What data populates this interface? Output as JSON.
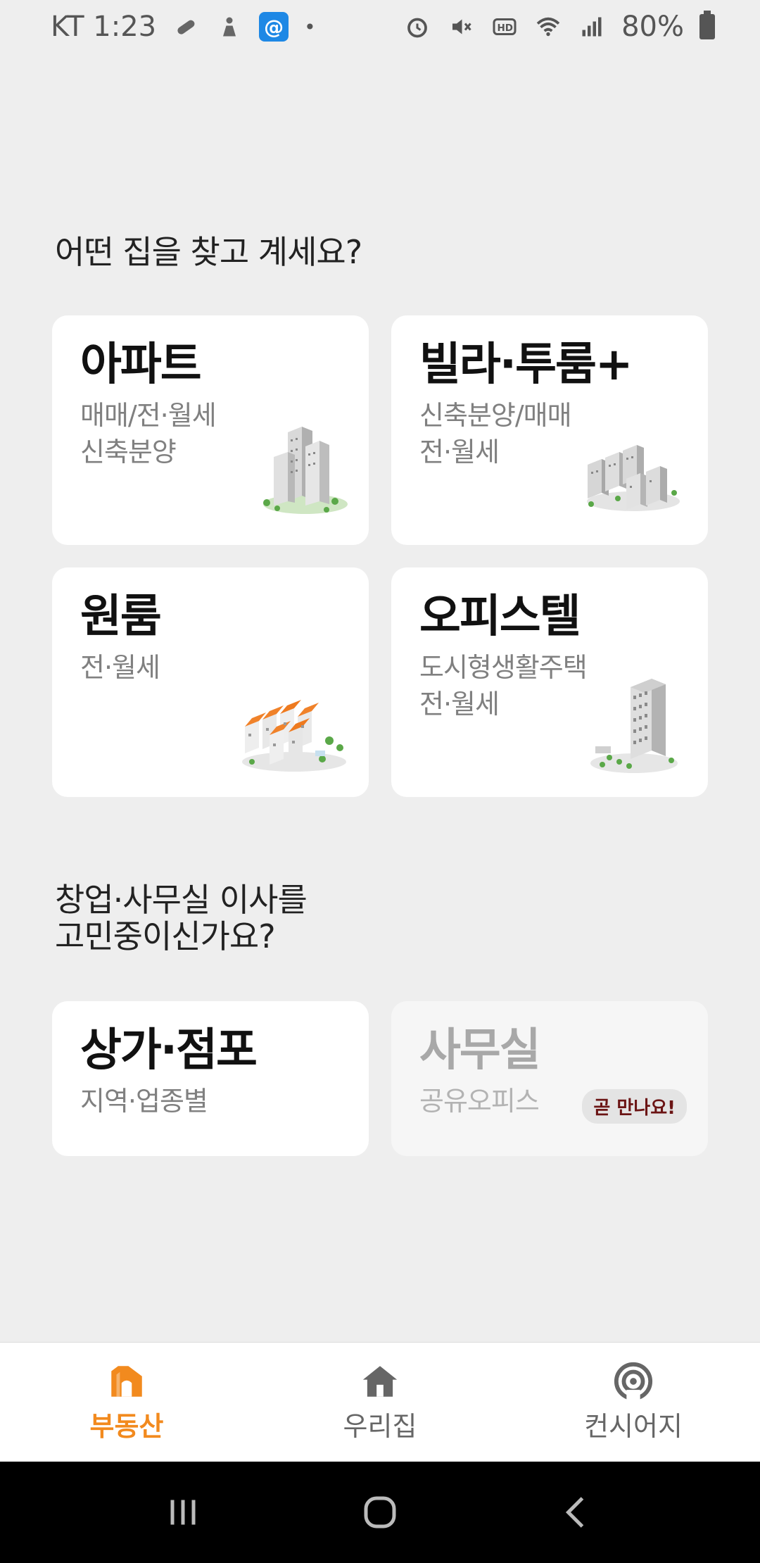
{
  "status_bar": {
    "carrier_time": "KT 1:23",
    "battery": "80%",
    "left_icons": [
      "pill-icon",
      "person-icon",
      "app-icon",
      "dot"
    ],
    "right_icons": [
      "alarm-icon",
      "mute-icon",
      "hd-icon",
      "wifi-icon",
      "signal-icon",
      "battery-icon"
    ]
  },
  "home_section": {
    "title": "어떤 집을 찾고 계세요?",
    "cards": [
      {
        "title": "아파트",
        "sub1": "매매/전·월세",
        "sub2": "신축분양",
        "illustration": "apartment-buildings-illustration"
      },
      {
        "title": "빌라·투룸+",
        "sub1": "신축분양/매매",
        "sub2": "전·월세",
        "illustration": "villa-buildings-illustration"
      },
      {
        "title": "원룸",
        "sub1": "전·월세",
        "sub2": "",
        "illustration": "oneroom-houses-illustration"
      },
      {
        "title": "오피스텔",
        "sub1": "도시형생활주택",
        "sub2": "전·월세",
        "illustration": "officetel-building-illustration"
      }
    ]
  },
  "business_section": {
    "title_line1": "창업·사무실 이사를",
    "title_line2": "고민중이신가요?",
    "cards": [
      {
        "title": "상가·점포",
        "sub1": "지역·업종별"
      },
      {
        "title": "사무실",
        "sub1": "공유오피스",
        "badge": "곧 만나요!"
      }
    ]
  },
  "bottom_nav": {
    "items": [
      {
        "label": "부동산",
        "icon": "real-estate-icon",
        "active": true
      },
      {
        "label": "우리집",
        "icon": "home-icon",
        "active": false
      },
      {
        "label": "컨시어지",
        "icon": "concierge-icon",
        "active": false
      }
    ]
  },
  "colors": {
    "accent": "#f28a1e",
    "background": "#eeeeee",
    "card": "#ffffff",
    "badge_text": "#6b1414"
  }
}
